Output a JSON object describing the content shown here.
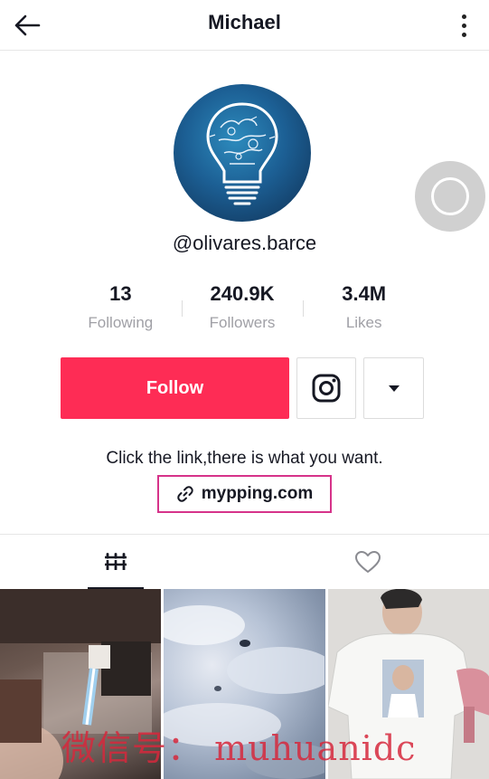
{
  "header": {
    "title": "Michael"
  },
  "profile": {
    "handle": "@olivares.barce",
    "stats": [
      {
        "value": "13",
        "label": "Following"
      },
      {
        "value": "240.9K",
        "label": "Followers"
      },
      {
        "value": "3.4M",
        "label": "Likes"
      }
    ],
    "follow_label": "Follow",
    "bio": "Click the link,there is what you want.",
    "link": "mypping.com"
  },
  "tabs": {
    "active": "videos"
  },
  "colors": {
    "accent": "#fe2c55",
    "link_border": "#d6338a"
  },
  "overlay": {
    "watermark": "微信号： muhuanidc"
  }
}
